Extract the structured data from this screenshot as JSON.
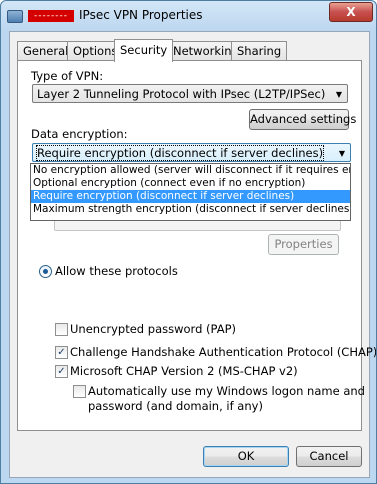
{
  "window": {
    "title": "IPsec VPN Properties",
    "title_redacted": "--------",
    "close_label": "X"
  },
  "tabs": [
    {
      "label": "General"
    },
    {
      "label": "Options"
    },
    {
      "label": "Security"
    },
    {
      "label": "Networking"
    },
    {
      "label": "Sharing"
    }
  ],
  "security": {
    "vpn_type_label": "Type of VPN:",
    "vpn_type_value": "Layer 2 Tunneling Protocol with IPsec (L2TP/IPSec)",
    "advanced_button": "Advanced settings",
    "encryption_label": "Data encryption:",
    "encryption_value": "Require encryption (disconnect if server declines)",
    "encryption_options": [
      "No encryption allowed (server will disconnect if it requires encryption)",
      "Optional encryption (connect even if no encryption)",
      "Require encryption (disconnect if server declines)",
      "Maximum strength encryption (disconnect if server declines)"
    ],
    "properties_button": "Properties",
    "allow_protocols_label": "Allow these protocols",
    "pap_label": "Unencrypted password (PAP)",
    "chap_label": "Challenge Handshake Authentication Protocol (CHAP)",
    "mschap_label": "Microsoft CHAP Version 2 (MS-CHAP v2)",
    "auto_logon_label_1": "Automatically use my Windows logon name and",
    "auto_logon_label_2": "password (and domain, if any)",
    "checked": {
      "pap": false,
      "chap": true,
      "mschap": true,
      "auto_logon": false
    }
  },
  "footer": {
    "ok": "OK",
    "cancel": "Cancel"
  },
  "icons": {
    "dropdown_arrow": "▼",
    "check": "✓"
  }
}
